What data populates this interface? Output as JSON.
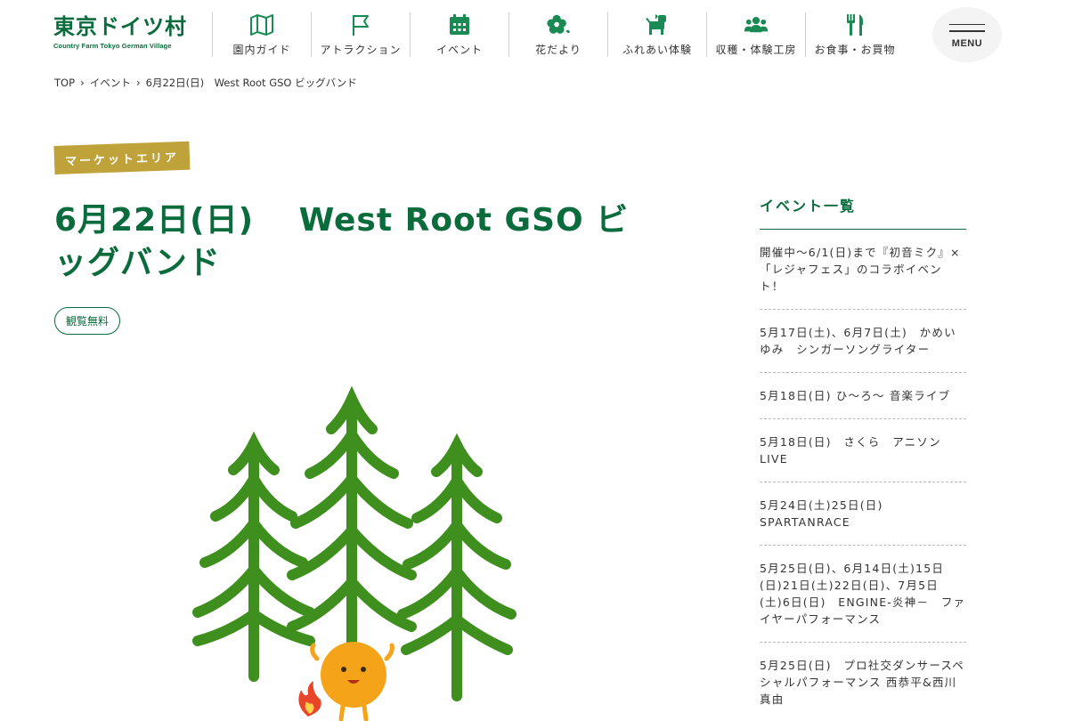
{
  "logo": {
    "main": "東京ドイツ村",
    "sub": "Country Farm Tokyo German Village"
  },
  "nav": [
    {
      "label": "園内ガイド",
      "icon": "map-icon"
    },
    {
      "label": "アトラクション",
      "icon": "flag-icon"
    },
    {
      "label": "イベント",
      "icon": "calendar-icon"
    },
    {
      "label": "花だより",
      "icon": "flower-icon"
    },
    {
      "label": "ふれあい体験",
      "icon": "dog-icon"
    },
    {
      "label": "収穫・体験工房",
      "icon": "people-icon"
    },
    {
      "label": "お食事・お買物",
      "icon": "cutlery-icon"
    }
  ],
  "menu": {
    "label": "MENU"
  },
  "breadcrumb": {
    "top": "TOP",
    "events": "イベント",
    "current": "6月22日(日)　West Root GSO ビッグバンド"
  },
  "main": {
    "tag": "マーケットエリア",
    "title": "6月22日(日)　 West Root GSO ビッグバンド",
    "badge": "観覧無料"
  },
  "sidebar": {
    "title": "イベント一覧",
    "events": [
      "開催中〜6/1(日)まで『初音ミク』×「レジャフェス」のコラボイベント！",
      "5月17日(土)、6月7日(土)　かめいゆみ　シンガーソングライター",
      "5月18日(日) ひ〜ろ〜 音楽ライブ",
      "5月18日(日)　さくら　アニソンLIVE",
      "5月24日(土)25日(日)\nSPARTANRACE",
      "5月25日(日)、6月14日(土)15日(日)21日(土)22日(日)、7月5日(土)6日(日)　ENGINE-炎神－　ファイヤーパフォーマンス",
      "5月25日(日)　プロ社交ダンサースペシャルパフォーマンス 西恭平&西川真由"
    ]
  },
  "colors": {
    "brand_green": "#0a6b3c",
    "tag_gold": "#bfa23a",
    "tree_green": "#3f8f1f",
    "character_orange": "#f5a41a"
  }
}
